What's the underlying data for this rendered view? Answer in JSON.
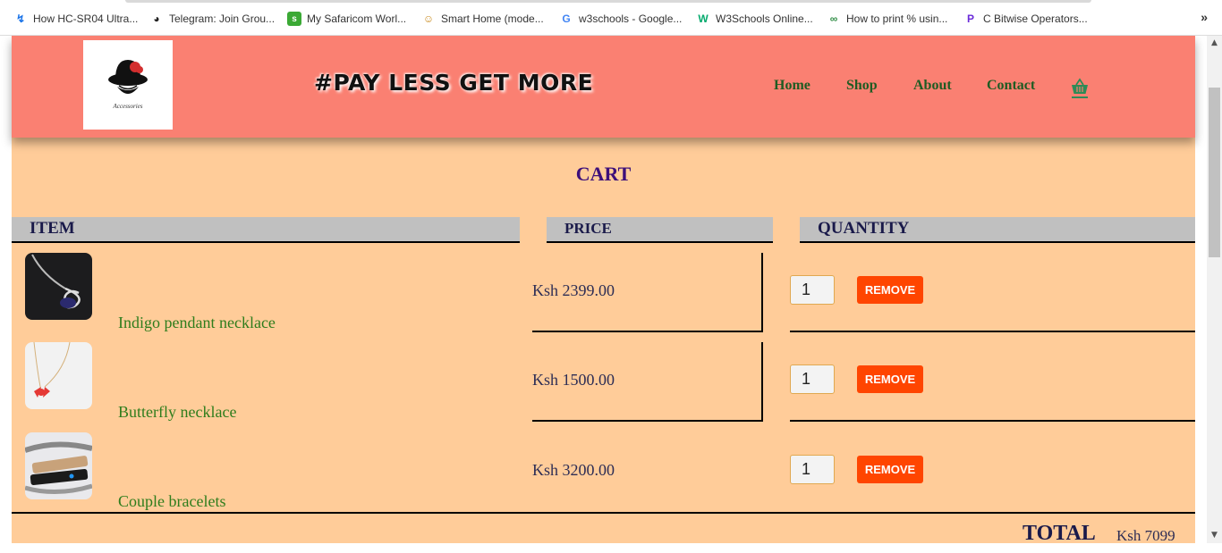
{
  "bookmarks": [
    {
      "label": "How HC-SR04 Ultra...",
      "icon": "lightning-icon",
      "color": "#1a73e8",
      "glyph": "↯"
    },
    {
      "label": "Telegram: Join Grou...",
      "icon": "globe-icon",
      "color": "#222222",
      "glyph": "◕"
    },
    {
      "label": "My Safaricom Worl...",
      "icon": "safaricom-icon",
      "color": "#3ba935",
      "glyph": "s"
    },
    {
      "label": "Smart Home (mode...",
      "icon": "smart-home-icon",
      "color": "#c98b1e",
      "glyph": "☺"
    },
    {
      "label": "w3schools - Google...",
      "icon": "google-icon",
      "color": "#4285f4",
      "glyph": "G"
    },
    {
      "label": "W3Schools Online...",
      "icon": "w3schools-icon",
      "color": "#04aa6d",
      "glyph": "W"
    },
    {
      "label": "How to print % usin...",
      "icon": "geeksforgeeks-icon",
      "color": "#2f8d46",
      "glyph": "∞"
    },
    {
      "label": "C Bitwise Operators...",
      "icon": "programiz-icon",
      "color": "#6a2bd9",
      "glyph": "P"
    }
  ],
  "bookmarks_more": "»",
  "header": {
    "logo_caption": "Accessories",
    "slogan": "#PAY LESS GET MORE",
    "nav": [
      "Home",
      "Shop",
      "About",
      "Contact"
    ],
    "basket_icon": "basket-icon",
    "bg_color": "#fa8072"
  },
  "cart": {
    "title": "CART",
    "columns": [
      "ITEM",
      "PRICE",
      "QUANTITY"
    ],
    "items": [
      {
        "name": "Indigo pendant necklace",
        "price": "Ksh 2399.00",
        "quantity": "1",
        "remove_label": "REMOVE",
        "image": "indigo-pendant-image"
      },
      {
        "name": "Butterfly necklace",
        "price": "Ksh 1500.00",
        "quantity": "1",
        "remove_label": "REMOVE",
        "image": "butterfly-necklace-image"
      },
      {
        "name": "Couple bracelets",
        "price": "Ksh 3200.00",
        "quantity": "1",
        "remove_label": "REMOVE",
        "image": "couple-bracelets-image"
      }
    ],
    "total_label": "TOTAL",
    "total_value": "Ksh 7099"
  },
  "colors": {
    "page_bg": "#ffcc99",
    "accent_remove": "#ff4500",
    "nav_text": "#1f5b22",
    "item_name": "#2e7d1c",
    "cart_title": "#3d0f7a"
  }
}
